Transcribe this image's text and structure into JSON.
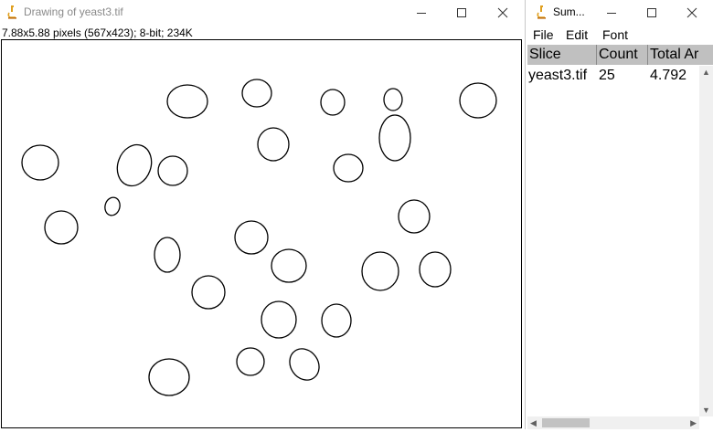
{
  "drawing_window": {
    "title": "Drawing of yeast3.tif",
    "info": "7.88x5.88 pixels (567x423); 8-bit; 234K",
    "icon": "microscope-icon",
    "controls": [
      "minimize-icon",
      "maximize-icon",
      "close-icon"
    ]
  },
  "summary_window": {
    "title": "Sum...",
    "icon": "microscope-icon",
    "menu": [
      "File",
      "Edit",
      "Font"
    ],
    "columns": [
      "Slice",
      "Count",
      "Total Ar"
    ],
    "rows": [
      {
        "slice": "yeast3.tif",
        "count": "25",
        "total_area": "4.792"
      }
    ]
  },
  "colors": {
    "outline": "#000000",
    "table_header_bg": "#c0c0c0",
    "scrollbar_bg": "#f0f0f0",
    "icon_accent": "#e0a020"
  }
}
